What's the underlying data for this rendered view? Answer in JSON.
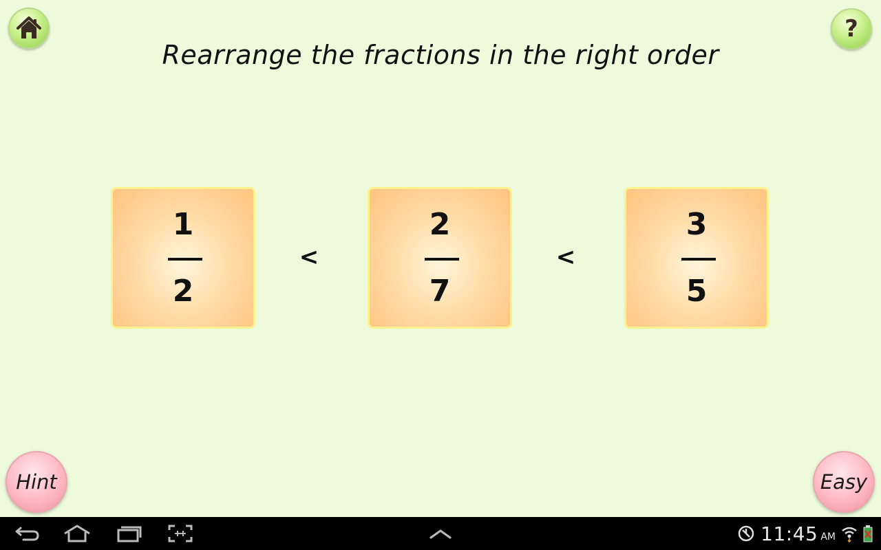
{
  "game": {
    "title": "Rearrange the fractions in the right order",
    "fractions": [
      {
        "numerator": "1",
        "denominator": "2"
      },
      {
        "numerator": "2",
        "denominator": "7"
      },
      {
        "numerator": "3",
        "denominator": "5"
      }
    ],
    "comparators": [
      "<",
      "<"
    ],
    "hint_label": "Hint",
    "difficulty_label": "Easy",
    "help_icon_label": "?"
  },
  "icons": {
    "home": "home-icon",
    "help": "question-mark-icon",
    "back": "back-arrow-icon",
    "nav_home": "nav-home-icon",
    "recent": "recent-apps-icon",
    "capture": "screen-capture-icon",
    "up": "chevron-up-icon",
    "status": "blocked-network-icon",
    "wifi": "wifi-icon",
    "battery": "battery-icon"
  },
  "system_bar": {
    "time": "11:45",
    "ampm": "AM"
  },
  "colors": {
    "background": "#edfadb",
    "card": "#ffc37e",
    "card_border": "#fbf28c",
    "hint_button": "#ffbcc5",
    "corner_button": "#c8ef8a"
  }
}
